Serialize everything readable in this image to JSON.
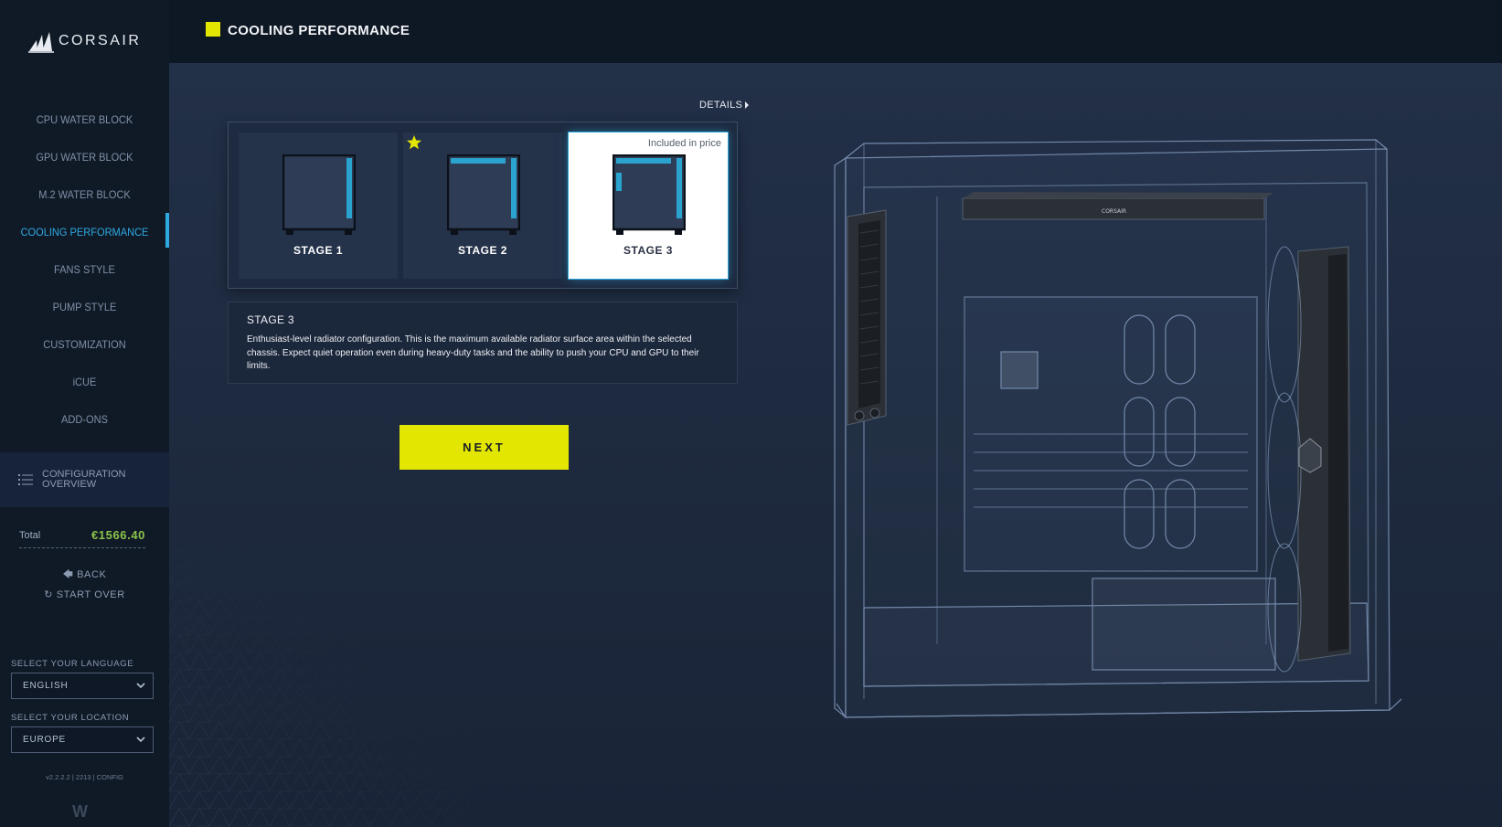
{
  "brand": {
    "name": "CORSAIR",
    "logo_icon": "corsair-sails-logo"
  },
  "nav": {
    "items": [
      {
        "label": "CPU WATER BLOCK",
        "active": false
      },
      {
        "label": "GPU WATER BLOCK",
        "active": false
      },
      {
        "label": "M.2 WATER BLOCK",
        "active": false
      },
      {
        "label": "COOLING PERFORMANCE",
        "active": true
      },
      {
        "label": "FANS STYLE",
        "active": false
      },
      {
        "label": "PUMP STYLE",
        "active": false
      },
      {
        "label": "CUSTOMIZATION",
        "active": false
      },
      {
        "label": "iCUE",
        "active": false
      },
      {
        "label": "ADD-ONS",
        "active": false
      }
    ],
    "active_color": "#2ea9e0"
  },
  "config_overview": {
    "label": "CONFIGURATION OVERVIEW",
    "icon": "list-icon"
  },
  "total": {
    "label": "Total",
    "value": "€1566.40",
    "color": "#8bc34a"
  },
  "actions": {
    "back": "BACK",
    "start_over": "START OVER"
  },
  "language": {
    "label": "SELECT YOUR LANGUAGE",
    "value": "ENGLISH"
  },
  "location": {
    "label": "SELECT YOUR LOCATION",
    "value": "EUROPE"
  },
  "version": "v2.2.2.2 | 2213 | CONFIG",
  "footer_logo": "W",
  "header": {
    "title": "COOLING PERFORMANCE",
    "accent": "#e3e600"
  },
  "details_link": "DETAILS",
  "stages": [
    {
      "name": "STAGE 1",
      "recommended": false,
      "selected": false,
      "note": ""
    },
    {
      "name": "STAGE 2",
      "recommended": true,
      "selected": false,
      "note": ""
    },
    {
      "name": "STAGE 3",
      "recommended": false,
      "selected": true,
      "note": "Included in price"
    }
  ],
  "description": {
    "title": "STAGE 3",
    "text": "Enthusiast-level radiator configuration. This is the maximum available radiator surface area within the selected chassis. Expect quiet operation even during heavy-duty tasks and the ability to push your CPU and GPU to their limits."
  },
  "next_button": "NEXT",
  "render": {
    "case_logo_text": "CORSAIR"
  }
}
